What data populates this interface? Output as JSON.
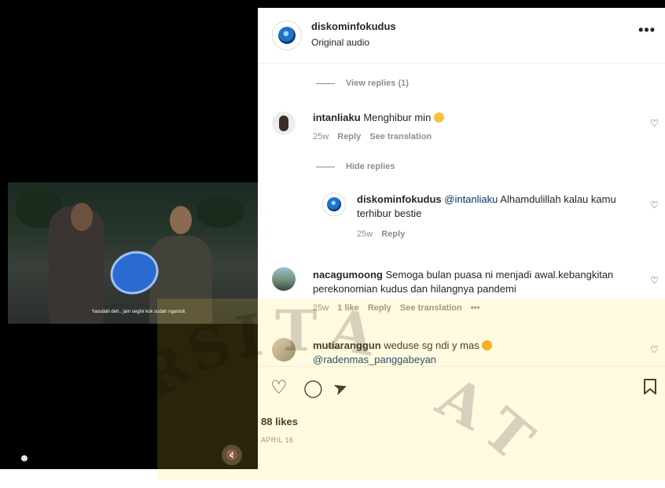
{
  "post": {
    "username": "diskominfokudus",
    "audio": "Original audio",
    "more": "•••"
  },
  "video": {
    "subtitle": "Yasudah deh.. jam segini kok sudah ngantuk",
    "user_icon": "person-icon",
    "mute_icon": "muted-speaker-icon"
  },
  "comments": {
    "view_replies": "View replies (1)",
    "hide_replies": "Hide replies",
    "c1": {
      "user": "intanliaku",
      "text": "Menghibur min",
      "time": "25w",
      "reply": "Reply",
      "translate": "See translation"
    },
    "r1": {
      "user": "diskominfokudus",
      "mention": "@intanliaku",
      "text": "Alhamdulillah kalau kamu terhibur bestie",
      "time": "25w",
      "reply": "Reply"
    },
    "c2": {
      "user": "nacagumoong",
      "text": "Semoga bulan puasa ni menjadi awal.kebangkitan perekonomian kudus dan hilangnya pandemi",
      "time": "25w",
      "likes": "1 like",
      "reply": "Reply",
      "translate": "See translation",
      "more": "•••"
    },
    "c3": {
      "user": "mutiaranggun",
      "text": "weduse sg ndi y mas",
      "mention": "@radenmas_panggabeyan"
    }
  },
  "actions": {
    "like_icon": "heart-icon",
    "comment_icon": "comment-icon",
    "share_icon": "send-icon",
    "save_icon": "bookmark-icon",
    "likes": "88 likes",
    "date": "APRIL 16"
  },
  "colors": {
    "text": "#262626",
    "secondary": "#8e8e8e",
    "mention": "#00376b"
  }
}
